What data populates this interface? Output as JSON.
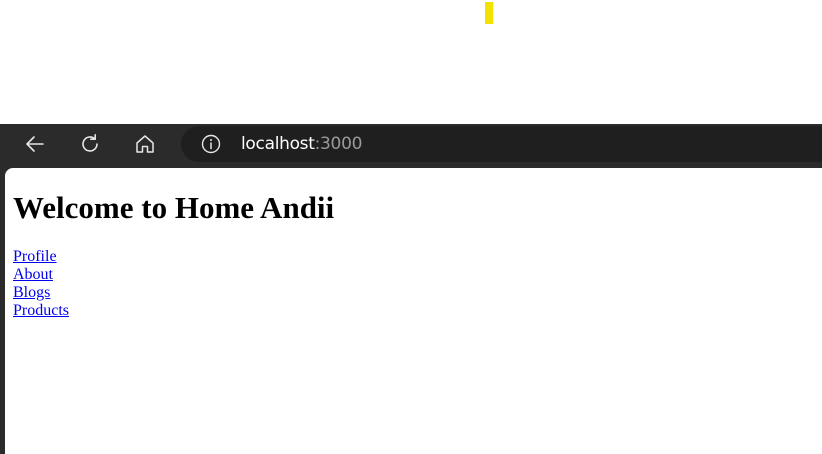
{
  "browser": {
    "url_host": "localhost",
    "url_port": ":3000",
    "icons": {
      "back": "back-arrow-icon",
      "refresh": "refresh-icon",
      "home": "home-icon",
      "info": "info-icon"
    }
  },
  "page": {
    "heading": "Welcome to Home Andii",
    "links": [
      {
        "label": "Profile"
      },
      {
        "label": "About"
      },
      {
        "label": "Blogs"
      },
      {
        "label": "Products"
      }
    ]
  },
  "colors": {
    "toolbar_bg": "#2b2b2b",
    "address_bar_bg": "#1f1f1f",
    "link": "#0000ee",
    "marker_yellow": "#f2e200"
  }
}
